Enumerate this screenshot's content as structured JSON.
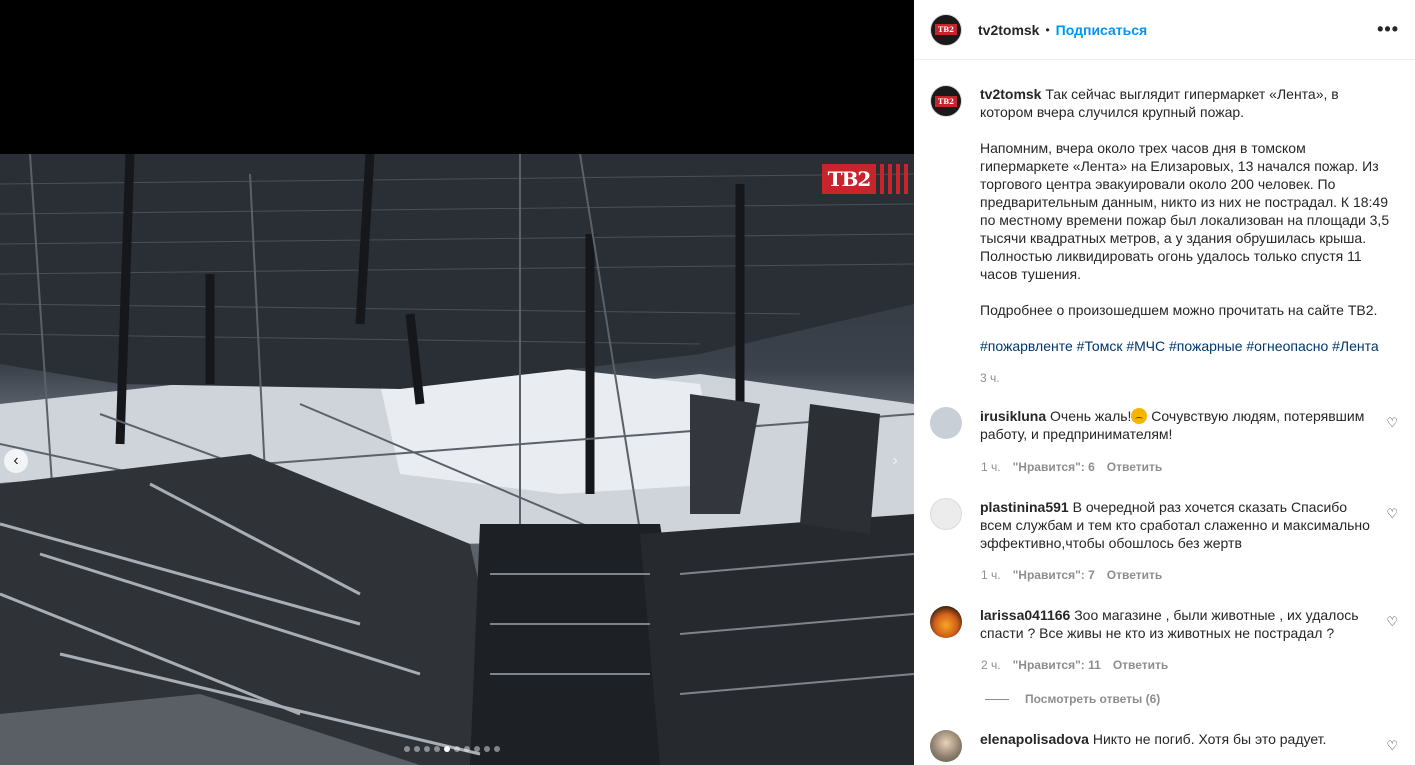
{
  "media": {
    "logo_text": "ТВ2",
    "prev_icon": "chevron-left-icon",
    "next_icon": "chevron-right-icon",
    "carousel_count": 10,
    "carousel_active": 4
  },
  "header": {
    "username": "tv2tomsk",
    "separator": "•",
    "follow_label": "Подписаться",
    "more_label": "•••",
    "avatar_text": "ТВ2"
  },
  "caption": {
    "username": "tv2tomsk",
    "lead": "Так сейчас выглядит гипермаркет «Лента», в котором вчера случился крупный пожар.",
    "paragraph1": "Напомним, вчера около трех часов дня в томском гипермаркете «Лента» на Елизаровых, 13 начался пожар. Из торгового центра эвакуировали около 200 человек. По предварительным данным, никто из них не пострадал. К 18:49 по местному времени пожар был локализован на площади 3,5 тысячи квадратных метров, а у здания обрушилась крыша. Полностью ликвидировать огонь удалось только спустя 11 часов тушения.",
    "paragraph2": "Подробнее о произошедшем можно прочитать на сайте ТВ2.",
    "hashtags": [
      "#пожарвленте",
      "#Томск",
      "#МЧС",
      "#пожарные",
      "#огнеопасно",
      "#Лента"
    ],
    "time": "3 ч."
  },
  "comments": [
    {
      "username": "irusikluna",
      "text_before": "Очень жаль!",
      "text_after": " Сочувствую людям, потерявшим работу, и предпринимателям!",
      "time": "1 ч.",
      "likes": "\"Нравится\": 6",
      "reply": "Ответить",
      "avatar_color": "#c9cfd6"
    },
    {
      "username": "plastinina591",
      "text": "В очередной раз хочется сказать Спасибо всем службам и тем кто сработал слаженно и максимально эффективно,чтобы обошлось без жертв",
      "time": "1 ч.",
      "likes": "\"Нравится\": 7",
      "reply": "Ответить",
      "avatar_color": "#e8e8e8"
    },
    {
      "username": "larissa041166",
      "text": "Зоо магазине , были животные , их удалось спасти ? Все живы не кто из животных не пострадал ?",
      "time": "2 ч.",
      "likes": "\"Нравится\": 11",
      "reply": "Ответить",
      "avatar_color": "#e07a1f",
      "view_replies": "Посмотреть ответы (6)"
    },
    {
      "username": "elenapolisadova",
      "text": "Никто не погиб. Хотя бы это радует.",
      "avatar_color": "#8a7a6a"
    }
  ]
}
